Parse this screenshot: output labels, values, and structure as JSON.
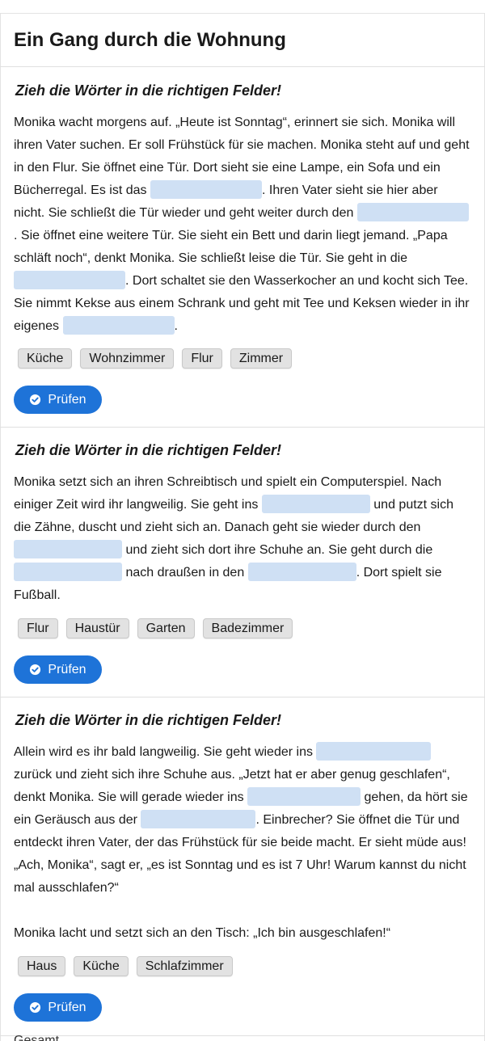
{
  "title": "Ein Gang durch die Wohnung",
  "check_label": "Prüfen",
  "footer_fragment": "Gesamt…",
  "exercises": [
    {
      "heading": "Zieh die Wörter in die richtigen Felder!",
      "text": [
        "Monika wacht morgens auf. „Heute ist Sonntag“, erinnert sie sich. Monika will",
        "ihren Vater suchen. Er soll Frühstück für sie machen. Monika steht auf und geht",
        "in den Flur. Sie öffnet eine Tür. Dort sieht sie eine Lampe, ein Sofa und ein",
        "Bücherregal. Es ist das",
        ". Ihren Vater sieht sie hier aber",
        "nicht. Sie schließt die Tür wieder und geht weiter durch den",
        ". Sie öffnet eine weitere Tür. Sie sieht ein Bett und darin liegt jemand. „Papa",
        "schläft noch“, denkt Monika. Sie schließt leise die Tür. Sie geht in die",
        ". Dort schaltet sie den Wasserkocher an und kocht sich Tee.",
        "Sie nimmt Kekse aus einem Schrank und geht mit Tee und Keksen wieder in ihr",
        "eigenes",
        "."
      ],
      "words": [
        "Küche",
        "Wohnzimmer",
        "Flur",
        "Zimmer"
      ]
    },
    {
      "heading": "Zieh die Wörter in die richtigen Felder!",
      "text": [
        "Monika setzt sich an ihren Schreibtisch und spielt ein Computerspiel. Nach",
        "einiger Zeit wird ihr langweilig. Sie geht ins",
        "und putzt sich",
        "die Zähne, duscht und zieht sich an. Danach geht sie wieder durch den",
        "und zieht sich dort ihre Schuhe an. Sie geht durch die",
        "nach draußen in den",
        ". Dort spielt sie",
        "Fußball."
      ],
      "words": [
        "Flur",
        "Haustür",
        "Garten",
        "Badezimmer"
      ]
    },
    {
      "heading": "Zieh die Wörter in die richtigen Felder!",
      "text": [
        "Allein wird es ihr bald langweilig. Sie geht wieder ins",
        "zurück und zieht sich ihre Schuhe aus. „Jetzt hat er aber genug geschlafen“,",
        "denkt Monika. Sie will gerade wieder ins",
        "gehen, da hört sie",
        "ein Geräusch aus der",
        ". Einbrecher?  Sie öffnet die Tür und",
        "entdeckt ihren Vater, der das Frühstück für sie beide macht. Er sieht müde aus!",
        "„Ach, Monika“, sagt er, „es ist Sonntag und es ist 7 Uhr! Warum kannst du nicht",
        "mal ausschlafen?“",
        "Monika lacht und setzt sich an den Tisch: „Ich bin ausgeschlafen!“"
      ],
      "words": [
        "Haus",
        "Küche",
        "Schlafzimmer"
      ]
    }
  ]
}
